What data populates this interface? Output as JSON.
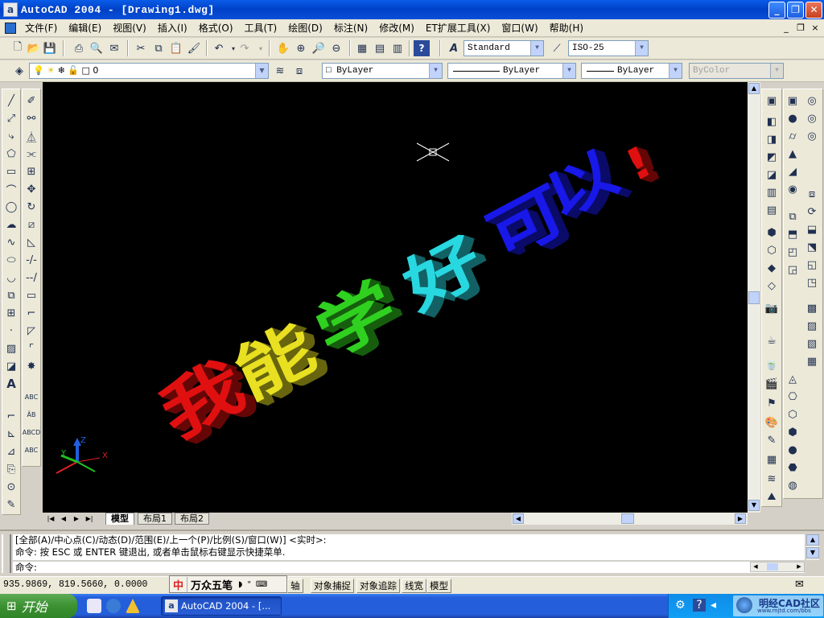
{
  "titlebar": {
    "app_icon": "a",
    "title": "AutoCAD 2004 - [Drawing1.dwg]",
    "buttons": {
      "minimize": "_",
      "restore": "❐",
      "close": "✕"
    }
  },
  "menubar": {
    "items": [
      "文件(F)",
      "编辑(E)",
      "视图(V)",
      "插入(I)",
      "格式(O)",
      "工具(T)",
      "绘图(D)",
      "标注(N)",
      "修改(M)",
      "ET扩展工具(X)",
      "窗口(W)",
      "帮助(H)"
    ],
    "doc_buttons": {
      "minimize": "_",
      "restore": "❐",
      "close": "×"
    }
  },
  "standard_toolbar": {
    "text_style": "Standard",
    "dim_style": "ISO-25"
  },
  "layers_toolbar": {
    "layer": "0",
    "color": "ByLayer",
    "linetype": "ByLayer",
    "lineweight": "ByLayer",
    "plotstyle": "ByColor"
  },
  "drawing": {
    "banner_text": [
      "我",
      "能",
      "学",
      "好",
      "可",
      "以",
      "!"
    ],
    "banner_colors": [
      "#e01010",
      "#e8e020",
      "#30d020",
      "#28d8e0",
      "#1818e8",
      "#e01010"
    ],
    "ucs": {
      "x": "X",
      "y": "Y",
      "z": "Z"
    }
  },
  "layout_tabs": {
    "tabs": [
      "模型",
      "布局1",
      "布局2"
    ],
    "active": "模型"
  },
  "command": {
    "line1": "[全部(A)/中心点(C)/动态(D)/范围(E)/上一个(P)/比例(S)/窗口(W)] <实时>:",
    "line2": "命令: 按 ESC 或 ENTER 键退出, 或者单击鼠标右键显示快捷菜单.",
    "prompt": "命令:"
  },
  "statusbar": {
    "coords": "935.9869,  819.5660, 0.0000",
    "ime": {
      "brand": "中",
      "name": "万众五笔"
    },
    "buttons": [
      "轴",
      "对象捕捉",
      "对象追踪",
      "线宽",
      "模型"
    ]
  },
  "taskbar": {
    "start": "开始",
    "task": "AutoCAD 2004 - [...",
    "watermark": "明经CAD社区",
    "watermark_url": "www.mjtd.com/bbs"
  },
  "colors": {
    "titlebar": "#0a5ce8",
    "canvas": "#000000",
    "toolbar": "#ece9d8",
    "taskbar": "#245edb"
  }
}
